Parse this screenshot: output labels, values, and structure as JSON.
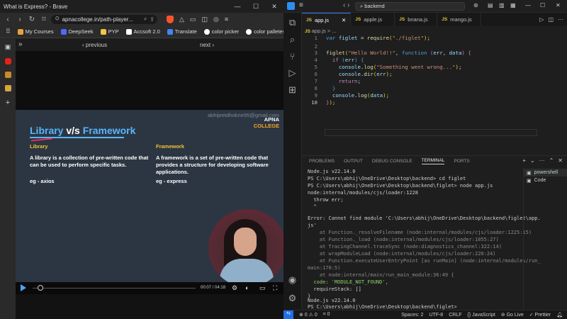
{
  "browser": {
    "window_title": "What is Express? - Brave",
    "url": "apnacollege.in/path-player...",
    "bookmarks": [
      {
        "label": "My Courses",
        "color": "#e9a23b"
      },
      {
        "label": "DeepSeek",
        "color": "#4d6bfe"
      },
      {
        "label": "PYP",
        "color": "#f4c542"
      },
      {
        "label": "Accsoft 2.0",
        "color": "#ffffff"
      },
      {
        "label": "Translate",
        "color": "#4285f4"
      },
      {
        "label": "color picker",
        "color": "#ffffff"
      },
      {
        "label": "color palletes",
        "color": "#ffffff"
      }
    ],
    "prev_label": "‹ previous",
    "next_label": "next ›",
    "slide": {
      "email": "abhijeetdhokne95@gmail.com",
      "brand_top": "APNA",
      "brand_bottom": "COLLEGE",
      "title_lib": "Library",
      "title_vs": " v/s ",
      "title_fw": "Framework",
      "col1_head": "Library",
      "col1_text": "A library is a collection of pre-written code that can be used to perform specific tasks.",
      "col1_eg": "eg - axios",
      "col2_head": "Framework",
      "col2_text": "A framework is a set of pre-written code that provides a structure for developing software applications.",
      "col2_eg": "eg - express"
    },
    "player": {
      "time": "00:07 / 04:18",
      "progress": 0.03
    }
  },
  "vscode": {
    "search": "backend",
    "tabs": [
      {
        "label": "app.js",
        "active": true
      },
      {
        "label": "apple.js",
        "active": false
      },
      {
        "label": "bnana.js",
        "active": false
      },
      {
        "label": "mango.js",
        "active": false
      }
    ],
    "breadcrumb": "app.js > ...",
    "code_lines": [
      {
        "n": "1",
        "text": "var figlet = require(\"./figlet\");"
      },
      {
        "n": "2",
        "text": ""
      },
      {
        "n": "3",
        "text": "figlet(\"Hello World!!\", function (err, data) {"
      },
      {
        "n": "4",
        "text": "  if (err) {"
      },
      {
        "n": "5",
        "text": "    console.log(\"Something went wrong...\");"
      },
      {
        "n": "6",
        "text": "    console.dir(err);"
      },
      {
        "n": "7",
        "text": "    return;"
      },
      {
        "n": "8",
        "text": "  }"
      },
      {
        "n": "9",
        "text": "  console.log(data);"
      },
      {
        "n": "10",
        "text": "});"
      }
    ],
    "panel_tabs": [
      "PROBLEMS",
      "OUTPUT",
      "DEBUG CONSOLE",
      "TERMINAL",
      "PORTS"
    ],
    "terminal_lines": [
      "Node.js v22.14.0",
      "PS C:\\Users\\abhij\\OneDrive\\Desktop\\backend> cd figlet",
      "PS C:\\Users\\abhij\\OneDrive\\Desktop\\backend\\figlet> node app.js",
      "node:internal/modules/cjs/loader:1228",
      "  throw err;",
      "  ^",
      "",
      "Error: Cannot find module 'C:\\Users\\abhij\\OneDrive\\Desktop\\backend\\figlet\\app.",
      "js'",
      "    at Function._resolveFilename (node:internal/modules/cjs/loader:1225:15)",
      "    at Function._load (node:internal/modules/cjs/loader:1055:27)",
      "    at TracingChannel.traceSync (node:diagnostics_channel:322:14)",
      "    at wrapModuleLoad (node:internal/modules/cjs/loader:220:24)",
      "    at Function.executeUserEntryPoint [as runMain] (node:internal/modules/run_",
      "main:170:5)",
      "    at node:internal/main/run_main_module:36:49 {",
      "  code: 'MODULE_NOT_FOUND',",
      "  requireStack: []",
      "}",
      "",
      "Node.js v22.14.0",
      "PS C:\\Users\\abhij\\OneDrive\\Desktop\\backend\\figlet> "
    ],
    "terminal_list": [
      "powershell",
      "Code"
    ],
    "status": {
      "errors": "⊗ 0 ⚠ 0",
      "ports": "⌗ 0",
      "spaces": "Spaces: 2",
      "encoding": "UTF-8",
      "eol": "CRLF",
      "lang": "{} JavaScript",
      "golive": "Go Live",
      "prettier": "✓ Prettier"
    }
  }
}
